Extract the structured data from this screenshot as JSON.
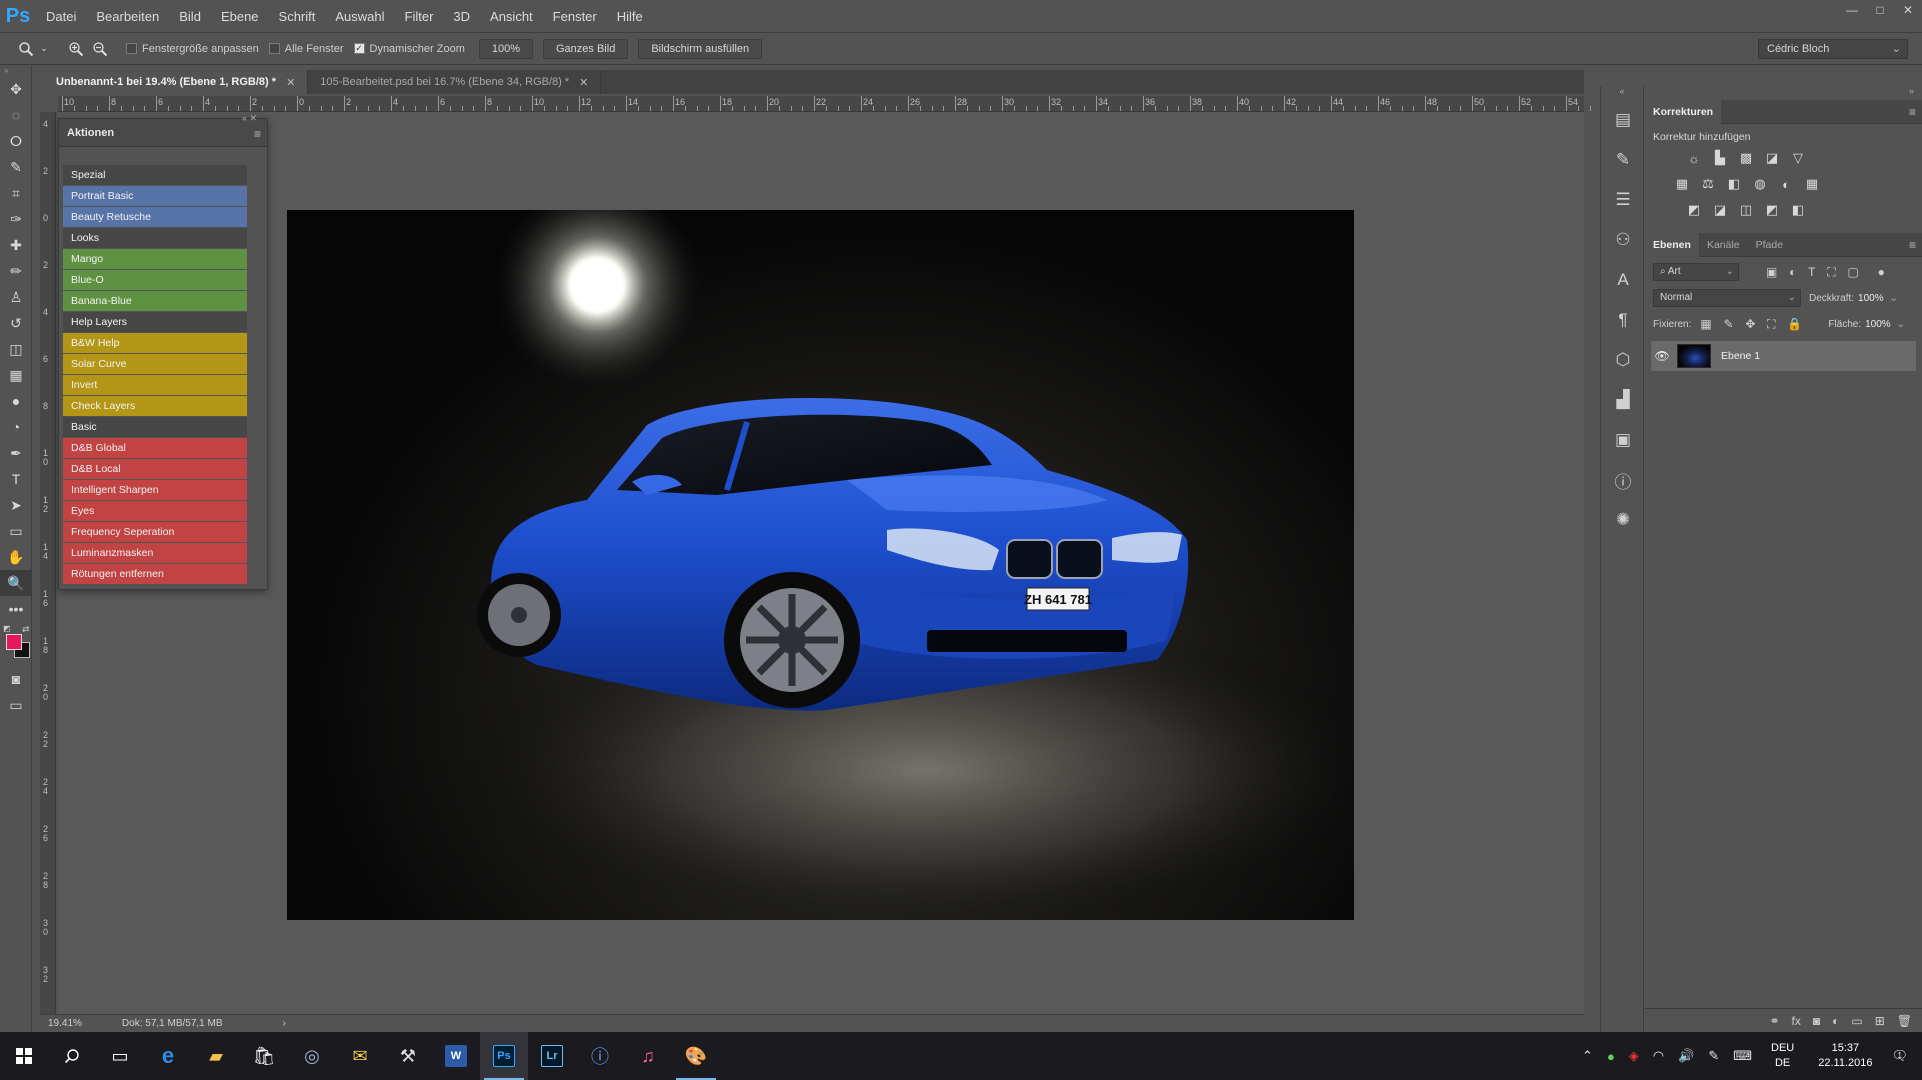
{
  "app": {
    "logo": "Ps"
  },
  "menu": [
    "Datei",
    "Bearbeiten",
    "Bild",
    "Ebene",
    "Schrift",
    "Auswahl",
    "Filter",
    "3D",
    "Ansicht",
    "Fenster",
    "Hilfe"
  ],
  "window_controls": {
    "minimize": "—",
    "maximize": "□",
    "close": "✕"
  },
  "options": {
    "fit_window_label": "Fenstergröße anpassen",
    "fit_window_checked": false,
    "all_windows_label": "Alle Fenster",
    "all_windows_checked": false,
    "scrubby_zoom_label": "Dynamischer Zoom",
    "scrubby_zoom_checked": true,
    "btn_100": "100%",
    "btn_fit": "Ganzes Bild",
    "btn_fill": "Bildschirm ausfüllen",
    "user": "Cédric Bloch"
  },
  "tools": [
    "move-tool",
    "marquee-tool",
    "lasso-tool",
    "quick-select-tool",
    "crop-tool",
    "eyedropper-tool",
    "healing-tool",
    "brush-tool",
    "stamp-tool",
    "history-brush-tool",
    "eraser-tool",
    "gradient-tool",
    "blur-tool",
    "dodge-tool",
    "pen-tool",
    "type-tool",
    "path-select-tool",
    "shape-tool",
    "hand-tool",
    "zoom-tool",
    "more-tools"
  ],
  "tool_glyphs": [
    "✥",
    "◌",
    "ⵔ",
    "✎",
    "⌗",
    "✑",
    "✚",
    "✏",
    "♙",
    "↺",
    "◫",
    "▦",
    "●",
    "◔",
    "✒",
    "T",
    "➤",
    "▭",
    "✋",
    "🔍",
    "•••"
  ],
  "foreground_color": "#e8175d",
  "background_color": "#111111",
  "doc_tabs": [
    {
      "label": "Unbenannt-1 bei 19.4% (Ebene 1, RGB/8) *",
      "active": true
    },
    {
      "label": "105-Bearbeitet.psd bei 16.7% (Ebene 34, RGB/8) *",
      "active": false
    }
  ],
  "ruler_top": [
    "10",
    "8",
    "6",
    "4",
    "2",
    "0",
    "2",
    "4",
    "6",
    "8",
    "10",
    "12",
    "14",
    "16",
    "18",
    "20",
    "22",
    "24",
    "26",
    "28",
    "30",
    "32",
    "34",
    "36",
    "38",
    "40",
    "42",
    "44",
    "46",
    "48",
    "50",
    "52",
    "54"
  ],
  "ruler_left": [
    "4",
    "2",
    "0",
    "2",
    "4",
    "6",
    "8",
    "1\n0",
    "1\n2",
    "1\n4",
    "1\n6",
    "1\n8",
    "2\n0",
    "2\n2",
    "2\n4",
    "2\n6",
    "2\n8",
    "3\n0",
    "3\n2"
  ],
  "status": {
    "zoom": "19.41%",
    "doc": "Dok: 57,1 MB/57,1 MB",
    "arrow": "›"
  },
  "actions_panel": {
    "title": "Aktionen",
    "items": [
      {
        "label": "Spezial",
        "color": "#474747"
      },
      {
        "label": "Portrait Basic",
        "color": "#5774a8"
      },
      {
        "label": "Beauty Retusche",
        "color": "#5774a8"
      },
      {
        "label": "Looks",
        "color": "#474747"
      },
      {
        "label": "Mango",
        "color": "#5e9141"
      },
      {
        "label": "Blue-O",
        "color": "#5e9141"
      },
      {
        "label": "Banana-Blue",
        "color": "#5e9141"
      },
      {
        "label": "Help Layers",
        "color": "#474747"
      },
      {
        "label": "B&W Help",
        "color": "#b39616"
      },
      {
        "label": "Solar Curve",
        "color": "#b39616"
      },
      {
        "label": "Invert",
        "color": "#b39616"
      },
      {
        "label": "Check Layers",
        "color": "#b39616"
      },
      {
        "label": "Basic",
        "color": "#474747"
      },
      {
        "label": "D&B Global",
        "color": "#c24343"
      },
      {
        "label": "D&B Local",
        "color": "#c24343"
      },
      {
        "label": "Intelligent Sharpen",
        "color": "#c24343"
      },
      {
        "label": "Eyes",
        "color": "#c24343"
      },
      {
        "label": "Frequency Seperation",
        "color": "#c24343"
      },
      {
        "label": "Luminanzmasken",
        "color": "#c24343"
      },
      {
        "label": "Rötungen entfernen",
        "color": "#c24343"
      }
    ]
  },
  "corrections_panel": {
    "tab": "Korrekturen",
    "subtitle": "Korrektur hinzufügen",
    "rows": [
      [
        "☼",
        "▙",
        "▩",
        "◪",
        "▽"
      ],
      [
        "▦",
        "⚖",
        "◧",
        "◍",
        "◐",
        "▦"
      ],
      [
        "◩",
        "◪",
        "◫",
        "◩",
        "◧"
      ]
    ]
  },
  "layers_panel": {
    "tabs": [
      "Ebenen",
      "Kanäle",
      "Pfade"
    ],
    "filter": "⌕ Art",
    "blend_mode": "Normal",
    "opacity_label": "Deckkraft:",
    "opacity": "100%",
    "lock_label": "Fixieren:",
    "fill_label": "Fläche:",
    "fill": "100%",
    "layer_name": "Ebene 1"
  },
  "photo": {
    "plate": "ZH 641 781"
  },
  "taskbar": {
    "lang": "DEU",
    "lang2": "DE",
    "time": "15:37",
    "date": "22.11.2016",
    "notifications": "1"
  }
}
